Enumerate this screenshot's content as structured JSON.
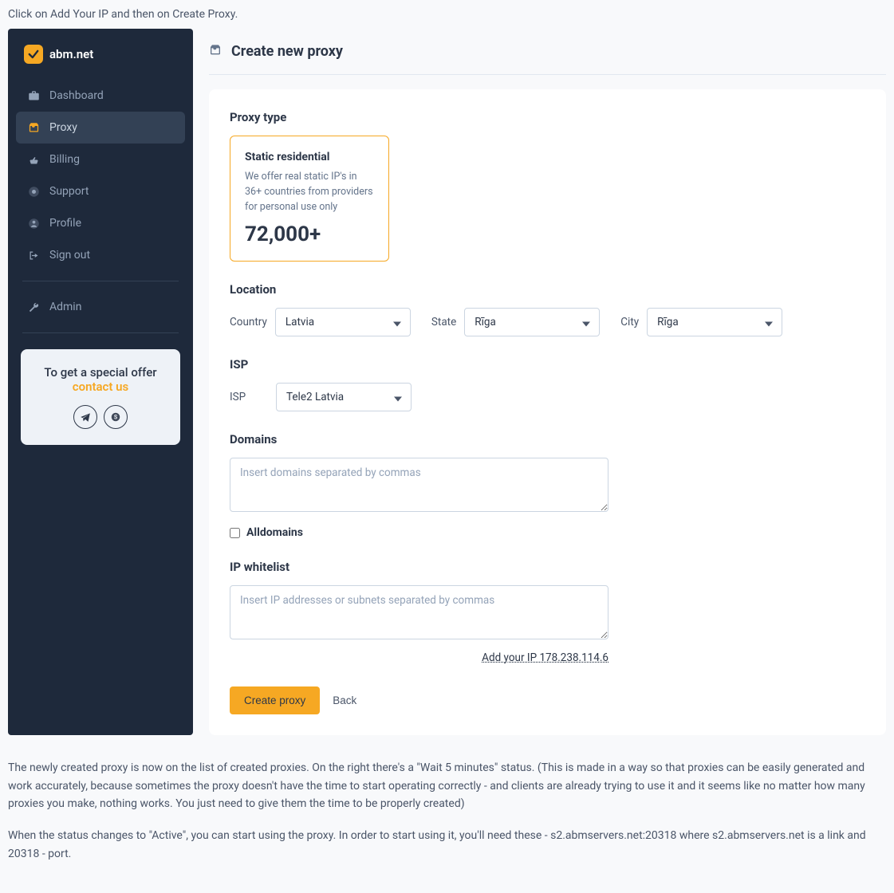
{
  "instructions": {
    "top": "Click on Add Your IP and then on Create Proxy.",
    "bottom1": "The newly created proxy is now on the list of created proxies. On the right there's a \"Wait 5 minutes\" status. (This is made in a way so that proxies can be easily generated and work accurately, because sometimes the proxy doesn't have the time to start operating correctly - and clients are already trying to use it and it seems like no matter how many proxies you make, nothing works. You just need to give them the time to be properly created)",
    "bottom2": "When the status changes to \"Active\", you can start using the proxy. In order to start using it, you'll need these - s2.abmservers.net:20318 where s2.abmservers.net is a link and 20318 - port."
  },
  "sidebar": {
    "logo_text": "abm.net",
    "items": [
      {
        "label": "Dashboard"
      },
      {
        "label": "Proxy"
      },
      {
        "label": "Billing"
      },
      {
        "label": "Support"
      },
      {
        "label": "Profile"
      },
      {
        "label": "Sign out"
      }
    ],
    "admin_label": "Admin",
    "offer": {
      "title": "To get a special offer",
      "link": "contact us"
    }
  },
  "header": {
    "title": "Create new proxy"
  },
  "form": {
    "proxy_type": {
      "section_label": "Proxy type",
      "title": "Static residential",
      "description": "We offer real static IP's in 36+ countries from providers for personal use only",
      "count": "72,000+"
    },
    "location": {
      "section_label": "Location",
      "country_label": "Country",
      "country_value": "Latvia",
      "state_label": "State",
      "state_value": "Rīga",
      "city_label": "City",
      "city_value": "Rīga"
    },
    "isp": {
      "section_label": "ISP",
      "label": "ISP",
      "value": "Tele2 Latvia"
    },
    "domains": {
      "section_label": "Domains",
      "placeholder": "Insert domains separated by commas",
      "alldomains_label": "Alldomains"
    },
    "ip_whitelist": {
      "section_label": "IP whitelist",
      "placeholder": "Insert IP addresses or subnets separated by commas",
      "add_ip_text": "Add your IP 178.238.114.6"
    },
    "buttons": {
      "create": "Create proxy",
      "back": "Back"
    }
  }
}
